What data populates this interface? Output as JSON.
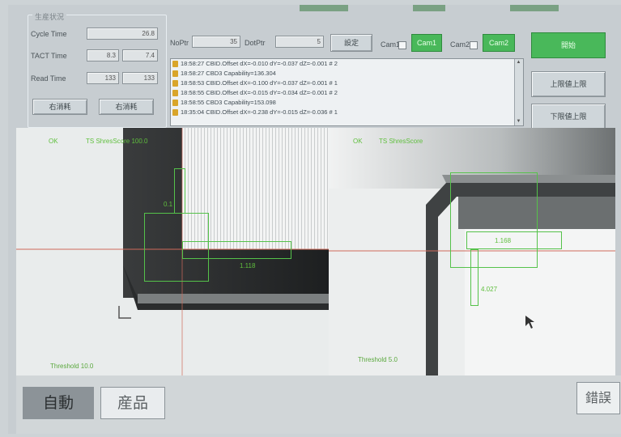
{
  "panel": {
    "title": "生産状況",
    "cycle_time_label": "Cycle Time",
    "cycle_time_value": "26.8",
    "tact_time_label": "TACT Time",
    "tact_time_values": [
      "8.3",
      "7.4"
    ],
    "read_time_label": "Read Time",
    "read_time_values": [
      "133",
      "133"
    ],
    "left_button": "右消耗",
    "right_button": "右消耗"
  },
  "params": {
    "p1_label": "NoPtr",
    "p1_value": "35",
    "p2_label": "DotPtr",
    "p2_value": "5",
    "set_button": "設定",
    "cam1_label": "Cam1",
    "cam1_button": "Cam1",
    "cam2_label": "Cam2",
    "cam2_button": "Cam2"
  },
  "log": {
    "rows": [
      "18:58:27 CBID.Offset dX=-0.010 dY=-0.037 dZ=-0.001 # 2",
      "18:58:27 CBD3 Capability=136.304",
      "18:58:53 CBID.Offset dX=-0.100 dY=-0.037 dZ=-0.001 # 1",
      "18:58:55 CBID.Offset dX=-0.015 dY=-0.034 dZ=-0.001 # 2",
      "18:58:55 CBD3 Capability=153.098",
      "18:35:04 CBID.Offset dX=-0.238 dY=-0.015 dZ=-0.036 # 1"
    ]
  },
  "side_buttons": {
    "top": "開始",
    "middle": "上限値上限",
    "bottom": "下限値上限"
  },
  "view_left": {
    "status": "OK",
    "header": "TS ShresScore 100.0",
    "measure_a": "0.1",
    "measure_b": "1.118",
    "threshold": "Threshold 10.0"
  },
  "view_right": {
    "status": "OK",
    "header": "TS ShresScore",
    "measure_a": "1.168",
    "measure_b": "4.027",
    "threshold": "Threshold 5.0"
  },
  "bottom": {
    "auto_button": "自動",
    "product_button": "産品",
    "error_button": "錯誤"
  },
  "colors": {
    "accent_green": "#49b85a",
    "overlay_green": "#55c24a",
    "crosshair_red": "#d06a5a"
  }
}
